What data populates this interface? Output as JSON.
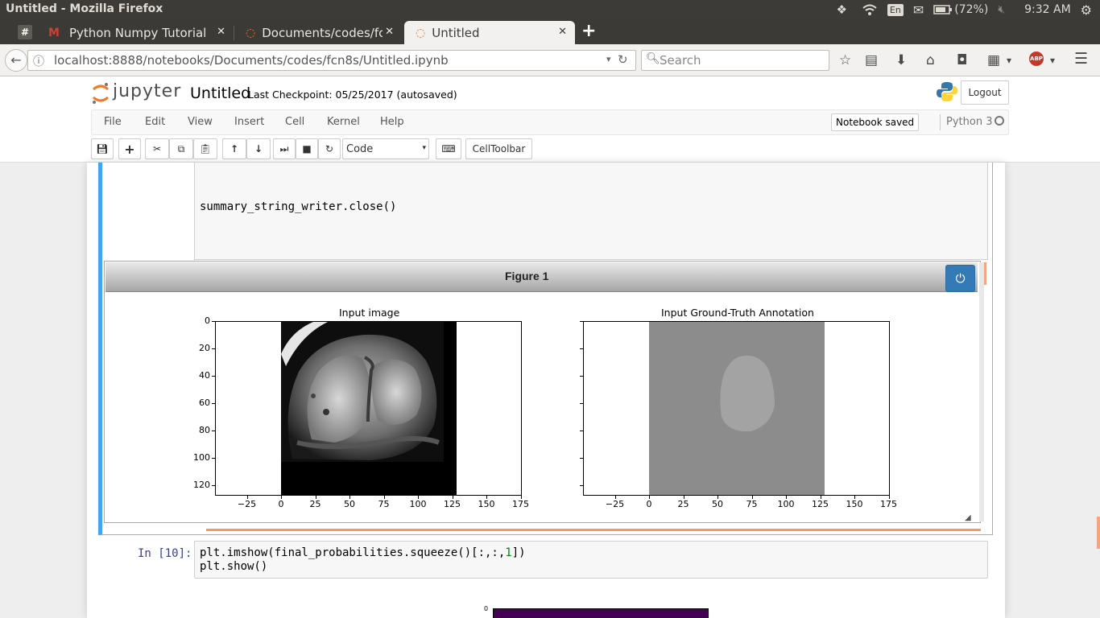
{
  "os": {
    "window_title": "Untitled - Mozilla Firefox",
    "keyboard": "En",
    "battery": "(72%)",
    "time": "9:32 AM"
  },
  "tabs": [
    {
      "label": "Python Numpy Tutorial",
      "icon": "gmail-icon"
    },
    {
      "label": "Documents/codes/fcn",
      "icon": "jupyter-icon"
    },
    {
      "label": "Untitled",
      "icon": "jupyter-icon"
    }
  ],
  "nav": {
    "url": "localhost:8888/notebooks/Documents/codes/fcn8s/Untitled.ipynb",
    "search_placeholder": "Search"
  },
  "jupyter": {
    "logo": "jupyter",
    "title": "Untitled",
    "checkpoint": "Last Checkpoint: 05/25/2017 (autosaved)",
    "logout": "Logout",
    "menu": [
      "File",
      "Edit",
      "View",
      "Insert",
      "Cell",
      "Kernel",
      "Help"
    ],
    "status": "Notebook saved",
    "kernel": "Python 3",
    "cell_type": "Code",
    "celltoolbar": "CellToolbar"
  },
  "cells": {
    "cell1_code": "summary_string_writer.close()",
    "figure_title": "Figure 1",
    "plot1_title": "Input image",
    "plot2_title": "Input Ground-Truth Annotation",
    "x_ticks": [
      "−25",
      "0",
      "25",
      "50",
      "75",
      "100",
      "125",
      "150",
      "175"
    ],
    "y_ticks": [
      "0",
      "20",
      "40",
      "60",
      "80",
      "100",
      "120"
    ],
    "cell2_prompt": "In [10]:",
    "cell2_line1_a": "plt.imshow(final_probabilities.squeeze()[:,:,",
    "cell2_line1_num": "1",
    "cell2_line1_b": "])",
    "cell2_line2": "plt.show()",
    "next_plot_tick": "0"
  },
  "colors": {
    "accent_blue": "#337ab7",
    "selected_cell": "#42a5f5",
    "orange_bar": "#f37726"
  }
}
